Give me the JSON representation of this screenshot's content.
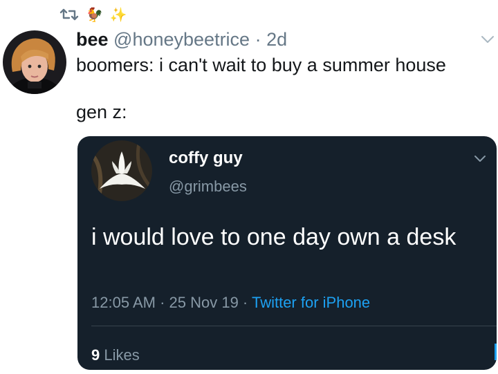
{
  "top_row": {
    "retweet_icon": "retweet-icon",
    "emoji_1": "🐓",
    "emoji_2": "✨"
  },
  "tweet": {
    "name": "bee",
    "handle": "@honeybeetrice",
    "separator": " · ",
    "time": "2d",
    "line1": "boomers: i can't wait to buy a summer house",
    "line2": "gen z:",
    "menu_icon": "chevron-down-icon"
  },
  "embedded": {
    "name": "coffy guy",
    "handle": "@grimbees",
    "text": "i would love to one day own a desk",
    "time": "12:05 AM",
    "separator": " · ",
    "date": "25 Nov 19",
    "source": "Twitter for iPhone",
    "likes_count": "9",
    "likes_label": "Likes",
    "menu_icon": "chevron-down-icon"
  },
  "colors": {
    "card_bg": "#15202b",
    "link_blue": "#1da1f2",
    "muted_gray": "#657786"
  }
}
